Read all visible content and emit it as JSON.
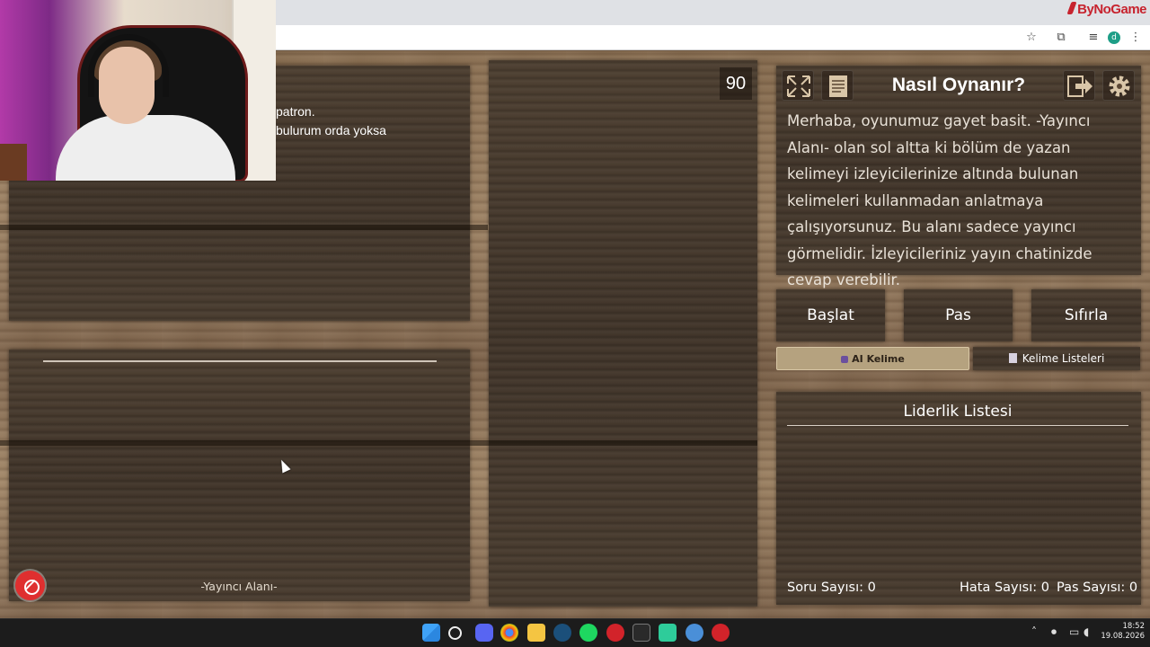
{
  "watermark": "ByNoGame",
  "browser": {
    "profile_initial": "d"
  },
  "chat": {
    "line1": "patron.",
    "line2": "bulurum orda yoksa"
  },
  "timer": "90",
  "howto": {
    "title": "Nasıl Oynanır?",
    "body": "Merhaba, oyunumuz gayet basit. -Yayıncı Alanı- olan sol altta ki bölüm de yazan kelimeyi izleyicilerinize altında bulunan kelimeleri kullanmadan anlatmaya çalışıyorsunuz. Bu alanı sadece yayıncı görmelidir. İzleyicileriniz yayın chatinizde cevap verebilir."
  },
  "controls": {
    "start": "Başlat",
    "pass": "Pas",
    "reset": "Sıfırla",
    "ai_word": "AI Kelime",
    "word_lists": "Kelime Listeleri"
  },
  "leaderboard": {
    "title": "Liderlik Listesi"
  },
  "stats": {
    "questions": "Soru Sayısı: 0",
    "errors": "Hata Sayısı: 0",
    "passes": "Pas Sayısı: 0"
  },
  "streamer_area_label": "-Yayıncı Alanı-",
  "taskbar": {
    "time": "18:52",
    "date": "19.08.2026"
  },
  "colors": {
    "wood_dark": "#41352a",
    "ai_button": "#b5a27f",
    "record_red": "#df2f2f",
    "brand_red": "#c7232e"
  }
}
